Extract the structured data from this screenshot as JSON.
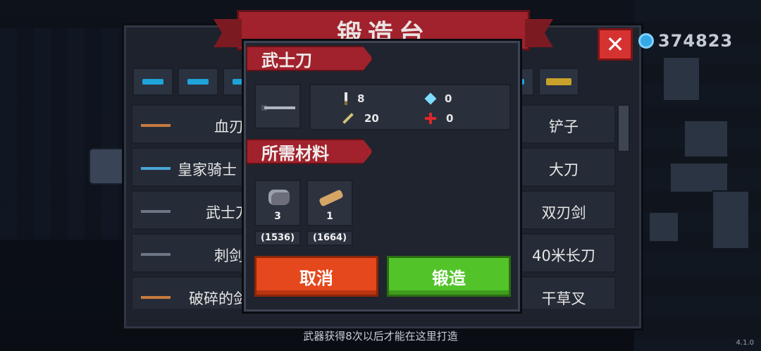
{
  "forge": {
    "title": "锻造台",
    "close_label": "✕",
    "gem_count": "374823",
    "tabs": [
      {
        "icon": "pistol-icon"
      },
      {
        "icon": "rifle-icon"
      },
      {
        "icon": "shotgun-icon"
      },
      {
        "icon": "launcher-icon"
      },
      {
        "icon": "bow-icon"
      },
      {
        "icon": "melee-icon"
      },
      {
        "icon": "staff-icon"
      },
      {
        "icon": "gun-icon"
      },
      {
        "icon": "fish-icon"
      },
      {
        "icon": "crown-icon"
      }
    ],
    "list_left": [
      {
        "name": "血刃"
      },
      {
        "name": "皇家骑士"
      },
      {
        "name": "武士刀"
      },
      {
        "name": "刺剑"
      },
      {
        "name": "破碎的剑"
      }
    ],
    "list_right": [
      {
        "name": "铲子"
      },
      {
        "name": "大刀"
      },
      {
        "name": "双刃剑"
      },
      {
        "name": "40米长刀"
      },
      {
        "name": "干草叉"
      }
    ]
  },
  "detail": {
    "weapon_name": "武士刀",
    "stats": {
      "damage": "8",
      "energy": "0",
      "critical": "20",
      "accuracy": "0"
    },
    "materials_label": "所需材料",
    "materials": [
      {
        "icon": "ore-icon",
        "qty": "3",
        "stock": "(1536)"
      },
      {
        "icon": "wood-icon",
        "qty": "1",
        "stock": "(1664)"
      }
    ],
    "cancel_label": "取消",
    "forge_label": "锻造"
  },
  "hint": "武器获得8次以后才能在这里打造",
  "version": "4.1.0",
  "colors": {
    "banner": "#a1222c",
    "cancel": "#e5481c",
    "forge": "#52c42a",
    "gem": "#35a8e6"
  }
}
